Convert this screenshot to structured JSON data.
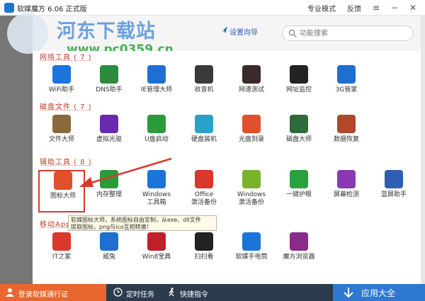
{
  "titlebar": {
    "title": "软媒魔方 6.06 正式版",
    "mode": "专业模式",
    "feedback": "反馈",
    "menu_glyph": "≡",
    "minimize_glyph": "−",
    "close_glyph": "✕"
  },
  "toolbar": {
    "wizard_label": "设置向导",
    "search_placeholder": "功能搜索"
  },
  "watermark": {
    "site_name": "河东下载站",
    "url": "www.pc0359.cn"
  },
  "sections": [
    {
      "title": "网络工具 ( 7 )",
      "tools": [
        {
          "label": "WiFi助手",
          "icon": "wifi-helper-icon",
          "color": "#1b74d9"
        },
        {
          "label": "DNS助手",
          "icon": "dns-helper-icon",
          "color": "#2d8c3c"
        },
        {
          "label": "IE管理大师",
          "icon": "ie-manager-icon",
          "color": "#1f6fd1"
        },
        {
          "label": "收音机",
          "icon": "radio-icon",
          "color": "#3a3a3a"
        },
        {
          "label": "网速测试",
          "icon": "speed-test-icon",
          "color": "#3a2a2a"
        },
        {
          "label": "网址监控",
          "icon": "url-monitor-icon",
          "color": "#222222"
        },
        {
          "label": "3G管家",
          "icon": "3g-manager-icon",
          "color": "#1e6fd0"
        }
      ]
    },
    {
      "title": "磁盘文件 ( 7 )",
      "tools": [
        {
          "label": "文件大师",
          "icon": "file-master-icon",
          "color": "#8a6a3c"
        },
        {
          "label": "虚拟光驱",
          "icon": "virtual-drive-icon",
          "color": "#6a2ab0"
        },
        {
          "label": "U盘启动",
          "icon": "usb-boot-icon",
          "color": "#2a9a3a"
        },
        {
          "label": "硬盘装机",
          "icon": "disk-install-icon",
          "color": "#2aa1c8"
        },
        {
          "label": "光盘刻录",
          "icon": "disc-burn-icon",
          "color": "#e0502a"
        },
        {
          "label": "磁盘大师",
          "icon": "disk-master-icon",
          "color": "#2f6a3a"
        },
        {
          "label": "数据恢复",
          "icon": "data-recovery-icon",
          "color": "#b0482a"
        }
      ]
    },
    {
      "title": "辅助工具 ( 8 )",
      "tools": [
        {
          "label": "图标大师",
          "icon": "icon-master-icon",
          "color": "#e0502a"
        },
        {
          "label": "内存整理",
          "icon": "memory-cleanup-icon",
          "color": "#2a9a3a"
        },
        {
          "label": "Windows\n工具箱",
          "icon": "windows-toolbox-icon",
          "color": "#1b74d9"
        },
        {
          "label": "Office\n激活备份",
          "icon": "office-activation-icon",
          "color": "#d9382c"
        },
        {
          "label": "Windows\n激活备份",
          "icon": "windows-activation-icon",
          "color": "#7ab22a"
        },
        {
          "label": "一键护眼",
          "icon": "eye-care-icon",
          "color": "#2aa13a"
        },
        {
          "label": "屏幕检测",
          "icon": "screen-test-icon",
          "color": "#8a3ab0"
        },
        {
          "label": "蓝屏助手",
          "icon": "bluescreen-helper-icon",
          "color": "#2f5fb0"
        }
      ]
    },
    {
      "title": "移动App",
      "tools": [
        {
          "label": "IT之家",
          "icon": "ithome-icon",
          "color": "#d9382c"
        },
        {
          "label": "威兔",
          "icon": "weitu-icon",
          "color": "#1f6fd1"
        },
        {
          "label": "Win8宝典",
          "icon": "win8-guide-icon",
          "color": "#c0202a"
        },
        {
          "label": "扫扫看",
          "icon": "qr-scan-icon",
          "color": "#222222"
        },
        {
          "label": "软媒手电筒",
          "icon": "flashlight-icon",
          "color": "#1b74d9"
        },
        {
          "label": "魔方浏览器",
          "icon": "mofang-browser-icon",
          "color": "#8a2a8a"
        }
      ]
    }
  ],
  "tooltip": {
    "line1": "软媒图标大师，系统图标自由定制，从exe、dll文件",
    "line2": "提取图标，png与ico互相转换！"
  },
  "bottombar": {
    "login_label": "登录软媒通行证",
    "scheduled_label": "定时任务",
    "shortcut_label": "快捷指令",
    "all_apps_label": "应用大全"
  }
}
